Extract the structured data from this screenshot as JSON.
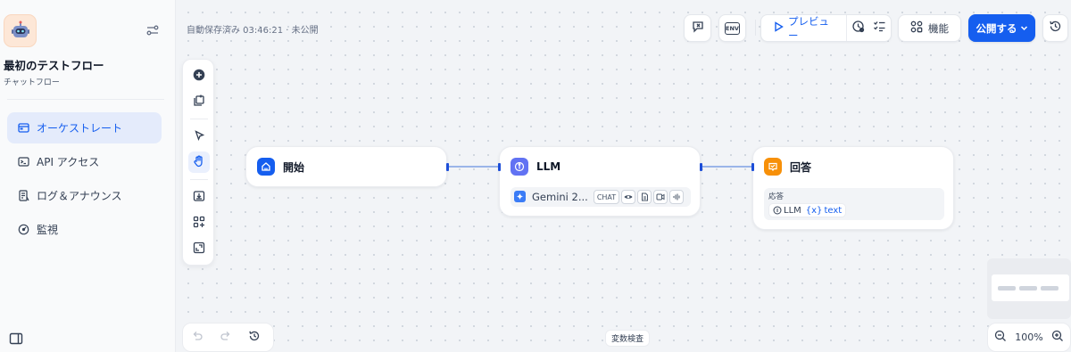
{
  "app": {
    "title": "最初のテストフロー",
    "subtitle": "チャットフロー",
    "icon": "robot-icon"
  },
  "sidebar": {
    "items": [
      {
        "label": "オーケストレート",
        "icon": "orchestrate-icon",
        "active": true
      },
      {
        "label": "API アクセス",
        "icon": "terminal-icon",
        "active": false
      },
      {
        "label": "ログ＆アナウンス",
        "icon": "log-icon",
        "active": false
      },
      {
        "label": "監視",
        "icon": "gauge-icon",
        "active": false
      }
    ]
  },
  "header": {
    "autosave": "自動保存済み 03:46:21 · 未公開",
    "env_label": "ENV",
    "preview_label": "プレビュー",
    "features_label": "機能",
    "publish_label": "公開する"
  },
  "nodes": {
    "start": {
      "title": "開始"
    },
    "llm": {
      "title": "LLM",
      "model": "Gemini 2...",
      "mode_chip": "CHAT"
    },
    "answer": {
      "title": "回答",
      "field_label": "応答",
      "source": "LLM",
      "var_symbol": "{x}",
      "var_name": "text"
    }
  },
  "footer": {
    "variable_inspect": "変数検査",
    "zoom": "100%"
  },
  "colors": {
    "accent": "#155eef",
    "start_icon": "#155eef",
    "llm_icon": "#6172f3",
    "answer_icon": "#f79009"
  }
}
